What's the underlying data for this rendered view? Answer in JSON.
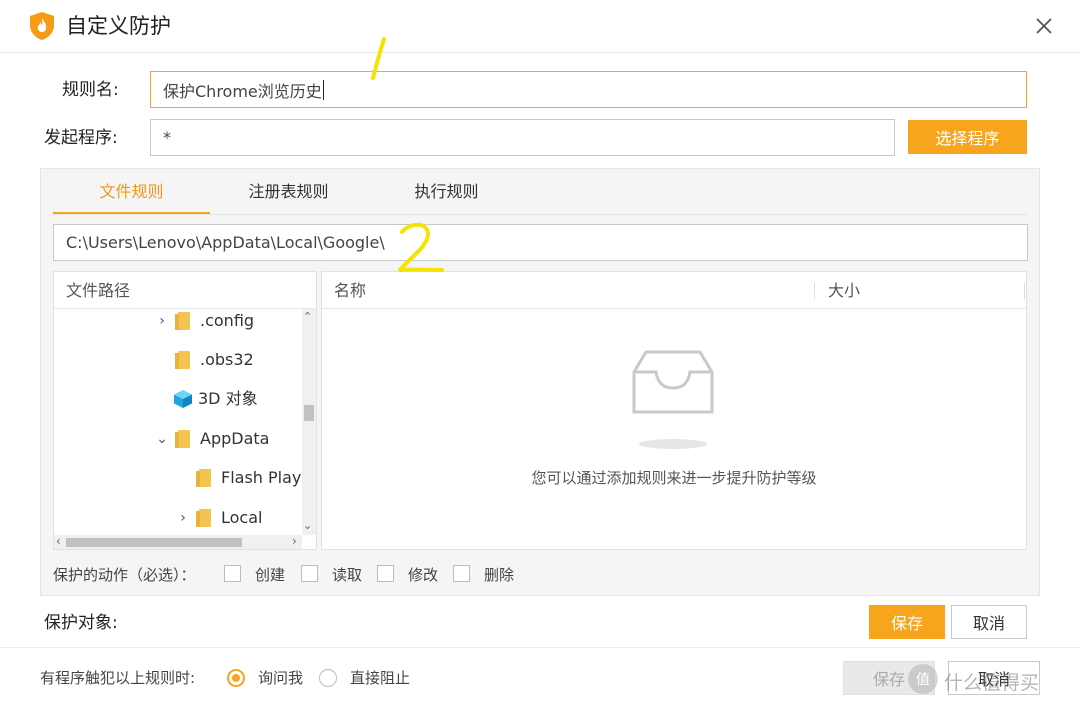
{
  "window": {
    "title": "自定义防护",
    "close_icon": "close-icon"
  },
  "rule_name": {
    "label": "规则名:",
    "value": "保护Chrome浏览历史"
  },
  "launcher": {
    "label": "发起程序:",
    "value": "*",
    "select_button": "选择程序"
  },
  "tabs": [
    {
      "label": "文件规则",
      "active": true
    },
    {
      "label": "注册表规则",
      "active": false
    },
    {
      "label": "执行规则",
      "active": false
    }
  ],
  "path_input": {
    "value": "C:\\Users\\Lenovo\\AppData\\Local\\Google\\"
  },
  "tree": {
    "header": "文件路径",
    "items": [
      {
        "label": ".config",
        "expander": "›",
        "icon": "folder-icon"
      },
      {
        "label": ".obs32",
        "expander": "",
        "icon": "folder-icon"
      },
      {
        "label": "3D 对象",
        "expander": "",
        "icon": "3d-objects-icon"
      },
      {
        "label": "AppData",
        "expander": "⌄",
        "icon": "folder-icon"
      },
      {
        "label": "Flash Playe",
        "expander": "",
        "icon": "folder-icon"
      },
      {
        "label": "Local",
        "expander": "›",
        "icon": "folder-icon"
      }
    ]
  },
  "file_list": {
    "columns": [
      "名称",
      "大小"
    ],
    "empty_text": "您可以通过添加规则来进一步提升防护等级",
    "empty_icon": "empty-inbox-icon"
  },
  "actions": {
    "label": "保护的动作（必选）：",
    "options": [
      "创建",
      "读取",
      "修改",
      "删除"
    ]
  },
  "protect_target": {
    "label": "保护对象:",
    "save": "保存",
    "cancel": "取消"
  },
  "footer": {
    "label": "有程序触犯以上规则时:",
    "options": [
      {
        "label": "询问我",
        "selected": true
      },
      {
        "label": "直接阻止",
        "selected": false
      }
    ],
    "save": "保存",
    "cancel": "取消"
  },
  "annotations": {
    "one": "1",
    "two": "2"
  },
  "watermark": "值 什么值得买",
  "colors": {
    "accent": "#f7a51c",
    "accent_text": "#f09a16",
    "annotation": "#f5e400"
  }
}
